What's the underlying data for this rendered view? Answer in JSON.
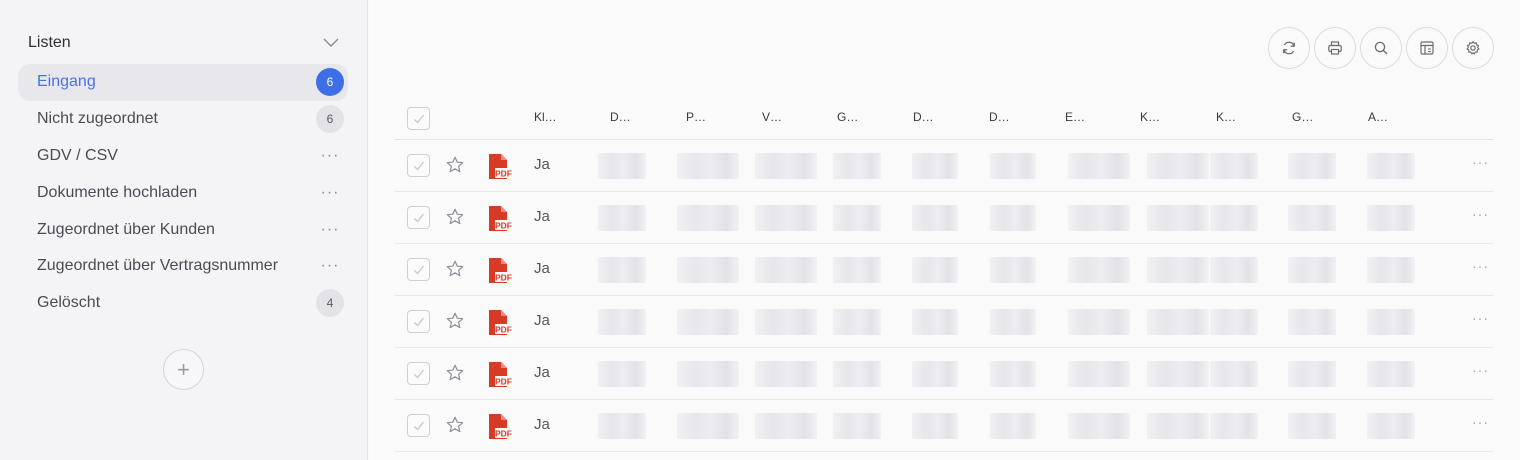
{
  "sidebar": {
    "title": "Listen",
    "items": [
      {
        "label": "Eingang",
        "badge": "6",
        "active": true
      },
      {
        "label": "Nicht zugeordnet",
        "badge": "6"
      },
      {
        "label": "GDV / CSV",
        "menu": "···"
      },
      {
        "label": "Dokumente hochladen",
        "menu": "···"
      },
      {
        "label": "Zugeordnet über Kunden",
        "menu": "···"
      },
      {
        "label": "Zugeordnet über Vertragsnummer",
        "menu": "···"
      },
      {
        "label": "Gelöscht",
        "badge": "4"
      }
    ],
    "add_label": "+"
  },
  "toolbar": {
    "icons": [
      "refresh-icon",
      "print-icon",
      "search-icon",
      "columns-icon",
      "gear-icon"
    ]
  },
  "table": {
    "columns": [
      "Kl…",
      "D…",
      "P…",
      "V…",
      "G…",
      "D…",
      "D…",
      "E…",
      "K…",
      "K…",
      "G…",
      "A…"
    ],
    "rows": [
      {
        "value": "Ja",
        "menu": "···"
      },
      {
        "value": "Ja",
        "menu": "···"
      },
      {
        "value": "Ja",
        "menu": "···"
      },
      {
        "value": "Ja",
        "menu": "···"
      },
      {
        "value": "Ja",
        "menu": "···"
      },
      {
        "value": "Ja",
        "menu": "···"
      }
    ],
    "pdf_label": "PDF"
  },
  "colors": {
    "accent": "#3f6fe6",
    "pdf_red": "#d93a26"
  }
}
